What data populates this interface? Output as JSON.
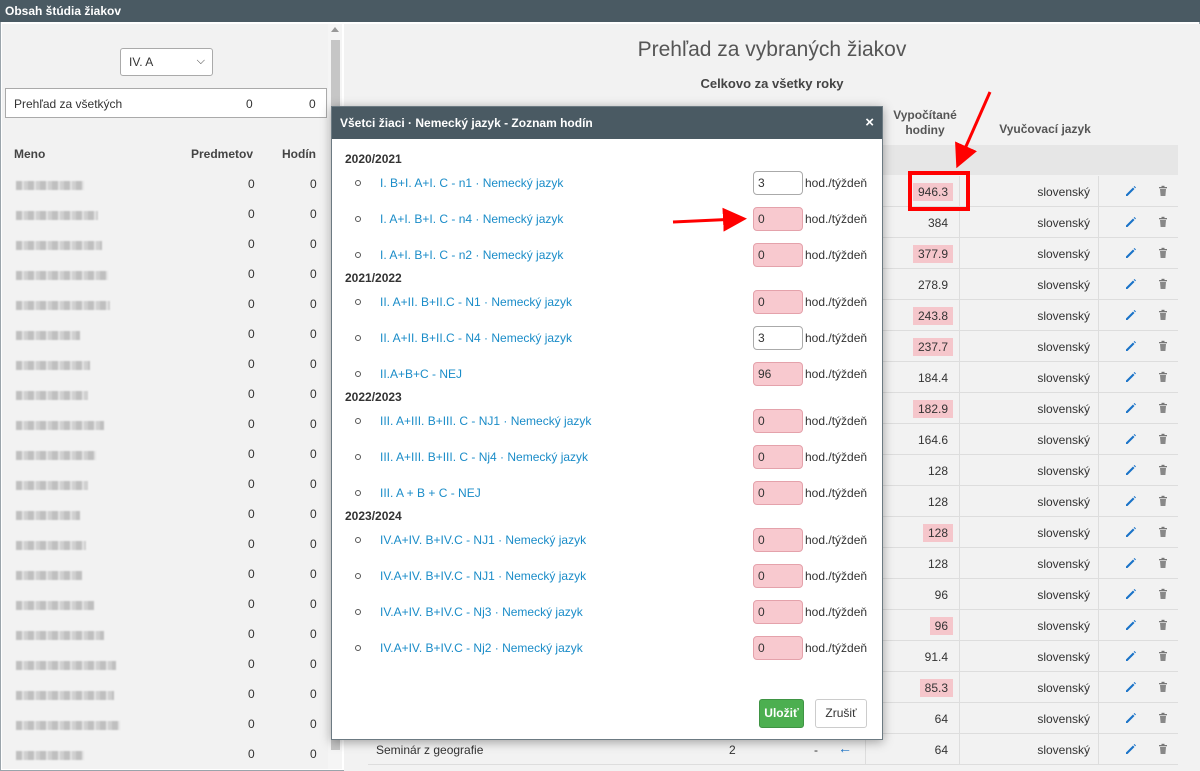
{
  "window": {
    "title": "Obsah štúdia žiakov"
  },
  "left": {
    "class_select": "IV. A",
    "summary": {
      "label": "Prehľad za všetkých",
      "subjects": "0",
      "hours": "0"
    },
    "headers": {
      "name": "Meno",
      "subjects": "Predmetov",
      "hours": "Hodín"
    },
    "rows": [
      {
        "subjects": "0",
        "hours": "0"
      },
      {
        "subjects": "0",
        "hours": "0"
      },
      {
        "subjects": "0",
        "hours": "0"
      },
      {
        "subjects": "0",
        "hours": "0"
      },
      {
        "subjects": "0",
        "hours": "0"
      },
      {
        "subjects": "0",
        "hours": "0"
      },
      {
        "subjects": "0",
        "hours": "0"
      },
      {
        "subjects": "0",
        "hours": "0"
      },
      {
        "subjects": "0",
        "hours": "0"
      },
      {
        "subjects": "0",
        "hours": "0"
      },
      {
        "subjects": "0",
        "hours": "0"
      },
      {
        "subjects": "0",
        "hours": "0"
      },
      {
        "subjects": "0",
        "hours": "0"
      },
      {
        "subjects": "0",
        "hours": "0"
      },
      {
        "subjects": "0",
        "hours": "0"
      },
      {
        "subjects": "0",
        "hours": "0"
      },
      {
        "subjects": "0",
        "hours": "0"
      },
      {
        "subjects": "0",
        "hours": "0"
      },
      {
        "subjects": "0",
        "hours": "0"
      },
      {
        "subjects": "0",
        "hours": "0"
      }
    ]
  },
  "main": {
    "title": "Prehľad za vybraných žiakov",
    "subtitle": "Celkovo za všetky roky",
    "col_hours_1": "Vypočítané",
    "col_hours_2": "hodiny",
    "col_language": "Vyučovací jazyk",
    "rows": [
      {
        "hours": "946.3",
        "pink": true,
        "language": "slovenský"
      },
      {
        "hours": "384",
        "pink": false,
        "language": "slovenský"
      },
      {
        "hours": "377.9",
        "pink": true,
        "language": "slovenský"
      },
      {
        "hours": "278.9",
        "pink": false,
        "language": "slovenský"
      },
      {
        "hours": "243.8",
        "pink": true,
        "language": "slovenský"
      },
      {
        "hours": "237.7",
        "pink": true,
        "language": "slovenský"
      },
      {
        "hours": "184.4",
        "pink": false,
        "language": "slovenský"
      },
      {
        "hours": "182.9",
        "pink": true,
        "language": "slovenský"
      },
      {
        "hours": "164.6",
        "pink": false,
        "language": "slovenský"
      },
      {
        "hours": "128",
        "pink": false,
        "language": "slovenský"
      },
      {
        "hours": "128",
        "pink": false,
        "language": "slovenský"
      },
      {
        "hours": "128",
        "pink": true,
        "language": "slovenský"
      },
      {
        "hours": "128",
        "pink": false,
        "language": "slovenský"
      },
      {
        "hours": "96",
        "pink": false,
        "language": "slovenský"
      },
      {
        "hours": "96",
        "pink": true,
        "language": "slovenský"
      },
      {
        "hours": "91.4",
        "pink": false,
        "language": "slovenský"
      },
      {
        "hours": "85.3",
        "pink": true,
        "language": "slovenský"
      },
      {
        "hours": "64",
        "pink": false,
        "language": "slovenský"
      },
      {
        "hours": "64",
        "pink": false,
        "language": "slovenský"
      }
    ],
    "last_row": {
      "subject": "Seminár z geografie",
      "count": "2",
      "dash": "-",
      "arrow": "←"
    }
  },
  "modal": {
    "title": "Všetci žiaci · Nemecký jazyk - Zoznam hodín",
    "close": "×",
    "unit": "hod./týždeň",
    "groups": [
      {
        "year": "2020/2021",
        "items": [
          {
            "label": "I. B+I. A+I. C - n1 · Nemecký jazyk",
            "value": "3",
            "pink": false
          },
          {
            "label": "I. A+I. B+I. C - n4 · Nemecký jazyk",
            "value": "0",
            "pink": true
          },
          {
            "label": "I. A+I. B+I. C - n2 · Nemecký jazyk",
            "value": "0",
            "pink": true
          }
        ]
      },
      {
        "year": "2021/2022",
        "items": [
          {
            "label": "II. A+II. B+II.C - N1 · Nemecký jazyk",
            "value": "0",
            "pink": true
          },
          {
            "label": "II. A+II. B+II.C - N4 · Nemecký jazyk",
            "value": "3",
            "pink": false
          },
          {
            "label": "II.A+B+C - NEJ",
            "value": "96",
            "pink": true
          }
        ]
      },
      {
        "year": "2022/2023",
        "items": [
          {
            "label": "III. A+III. B+III. C - NJ1 · Nemecký jazyk",
            "value": "0",
            "pink": true
          },
          {
            "label": "III. A+III. B+III. C - Nj4 · Nemecký jazyk",
            "value": "0",
            "pink": true
          },
          {
            "label": "III. A + B + C - NEJ",
            "value": "0",
            "pink": true
          }
        ]
      },
      {
        "year": "2023/2024",
        "items": [
          {
            "label": "IV.A+IV. B+IV.C - NJ1 · Nemecký jazyk",
            "value": "0",
            "pink": true
          },
          {
            "label": "IV.A+IV. B+IV.C - NJ1 · Nemecký jazyk",
            "value": "0",
            "pink": true
          },
          {
            "label": "IV.A+IV. B+IV.C - Nj3 · Nemecký jazyk",
            "value": "0",
            "pink": true
          },
          {
            "label": "IV.A+IV. B+IV.C - Nj2 · Nemecký jazyk",
            "value": "0",
            "pink": true
          }
        ]
      }
    ],
    "save_label": "Uložiť",
    "cancel_label": "Zrušiť"
  },
  "colors": {
    "header": "#4a5a63",
    "pink": "#f5c6cb",
    "link": "#1a8cc8",
    "save": "#4caf50",
    "annotation": "#ff0000"
  }
}
